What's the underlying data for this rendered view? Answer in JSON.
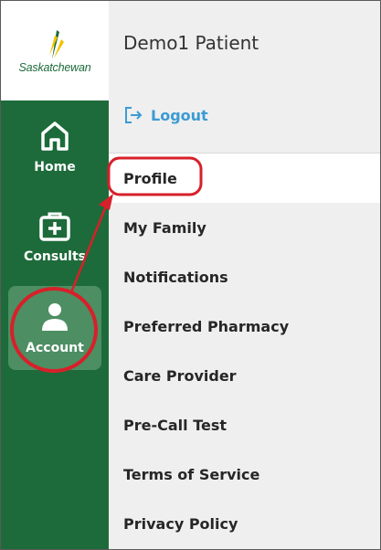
{
  "sidebar": {
    "logo_text": "Saskatchewan",
    "nav": [
      {
        "label": "Home",
        "icon": "home-icon"
      },
      {
        "label": "Consults",
        "icon": "medical-kit-icon"
      },
      {
        "label": "Account",
        "icon": "person-icon",
        "active": true
      }
    ]
  },
  "header": {
    "title": "Demo1 Patient"
  },
  "logout": {
    "label": "Logout",
    "icon": "logout-icon"
  },
  "menu": {
    "items": [
      {
        "label": "Profile",
        "selected": true
      },
      {
        "label": "My Family"
      },
      {
        "label": "Notifications"
      },
      {
        "label": "Preferred Pharmacy"
      },
      {
        "label": "Care Provider"
      },
      {
        "label": "Pre-Call Test"
      },
      {
        "label": "Terms of Service"
      },
      {
        "label": "Privacy Policy"
      }
    ]
  },
  "colors": {
    "sidebar_green": "#1d6b3a",
    "active_green": "#4d8e63",
    "link_blue": "#3b9bd3",
    "annotation_red": "#d7202a"
  }
}
